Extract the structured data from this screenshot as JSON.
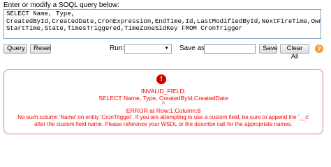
{
  "prompt": "Enter or modify a SOQL query below:",
  "query": "SELECT Name, Type,\nCreatedById,CreatedDate,CronExpression,EndTime,Id,LastModifiedById,NextFireTime,OwnerId,PreviousFireTime,\nStartTime,State,TimesTriggered,TimeZoneSidKey FROM CronTrigger",
  "buttons": {
    "query": "Query",
    "reset": "Reset",
    "save": "Save",
    "clear_all": "Clear All"
  },
  "run_label": "Run:",
  "run_selected": "",
  "save_as_label": "Save as:",
  "save_as_value": "",
  "help_icon": "?",
  "error": {
    "icon": "!",
    "title": "INVALID_FIELD:",
    "query_excerpt": "SELECT Name, Type, CreatedById,CreatedDate",
    "caret": "^",
    "location": "ERROR at Row:1:Column:8",
    "message_line1": "No such column 'Name' on entity 'CronTrigger'. If you are attempting to use a custom field, be sure to append the '__c'",
    "message_line2": "after the custom field name. Please reference your WSDL or the describe call for the appropriate names."
  },
  "colors": {
    "error_text": "#ff0000",
    "error_border": "#e08080",
    "error_icon": "#d00000",
    "help_icon": "#f0a030"
  }
}
